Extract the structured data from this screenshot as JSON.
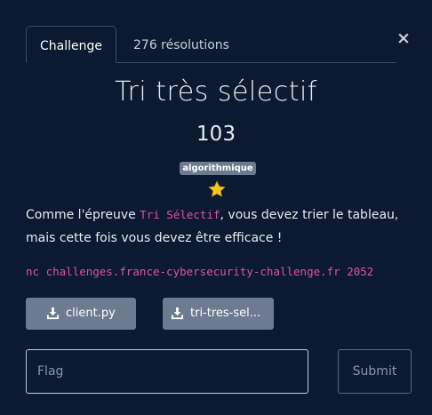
{
  "tabs": {
    "challenge": "Challenge",
    "solves": "276 résolutions"
  },
  "close_icon": "×",
  "challenge": {
    "title": "Tri très sélectif",
    "points": "103",
    "tag": "algorithmique",
    "difficulty_stars": 1,
    "description": {
      "before": "Comme l'épreuve ",
      "code": "Tri Sélectif",
      "after": ", vous devez trier le tableau, mais cette fois vous devez être efficace !"
    },
    "command": "nc challenges.france-cybersecurity-challenge.fr 2052"
  },
  "files": [
    {
      "label": "client.py",
      "icon": "download-icon"
    },
    {
      "label": "tri-tres-sel...",
      "icon": "download-icon"
    }
  ],
  "form": {
    "flag_placeholder": "Flag",
    "submit_label": "Submit"
  },
  "colors": {
    "background": "#0b1a30",
    "accent_code": "#e0529b",
    "button": "#6d7b91",
    "star": "#f5c518"
  }
}
